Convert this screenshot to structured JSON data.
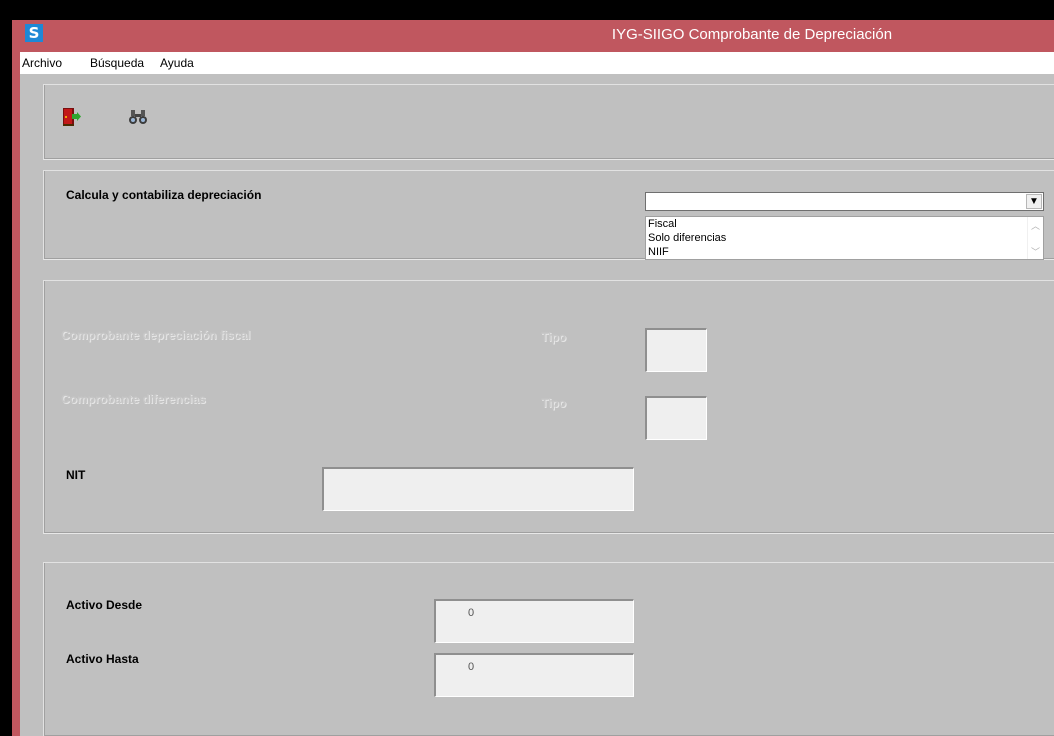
{
  "window": {
    "title": "IYG-SIIGO Comprobante de Depreciación",
    "app_icon_letter": "S",
    "colors": {
      "titlebar": "#c0575f",
      "client": "#c0c0c0",
      "icon": "#1e88d6"
    }
  },
  "menu": {
    "items": [
      "Archivo",
      "Búsqueda",
      "Ayuda"
    ]
  },
  "toolbar": {
    "exit_icon": "exit-door-icon",
    "search_icon": "binoculars-icon"
  },
  "calc_section": {
    "label": "Calcula y contabiliza depreciación",
    "select_value": "",
    "options": [
      "Fiscal",
      "Solo diferencias",
      "NIIF"
    ]
  },
  "voucher_section": {
    "fiscal_label": "Comprobante depreciación fiscal",
    "fiscal_tipo_label": "Tipo",
    "fiscal_tipo_value": "",
    "diff_label": "Comprobante diferencias",
    "diff_tipo_label": "Tipo",
    "diff_tipo_value": "",
    "nit_label": "NIT",
    "nit_value": ""
  },
  "asset_section": {
    "from_label": "Activo Desde",
    "from_value": "0",
    "to_label": "Activo Hasta",
    "to_value": "0"
  }
}
